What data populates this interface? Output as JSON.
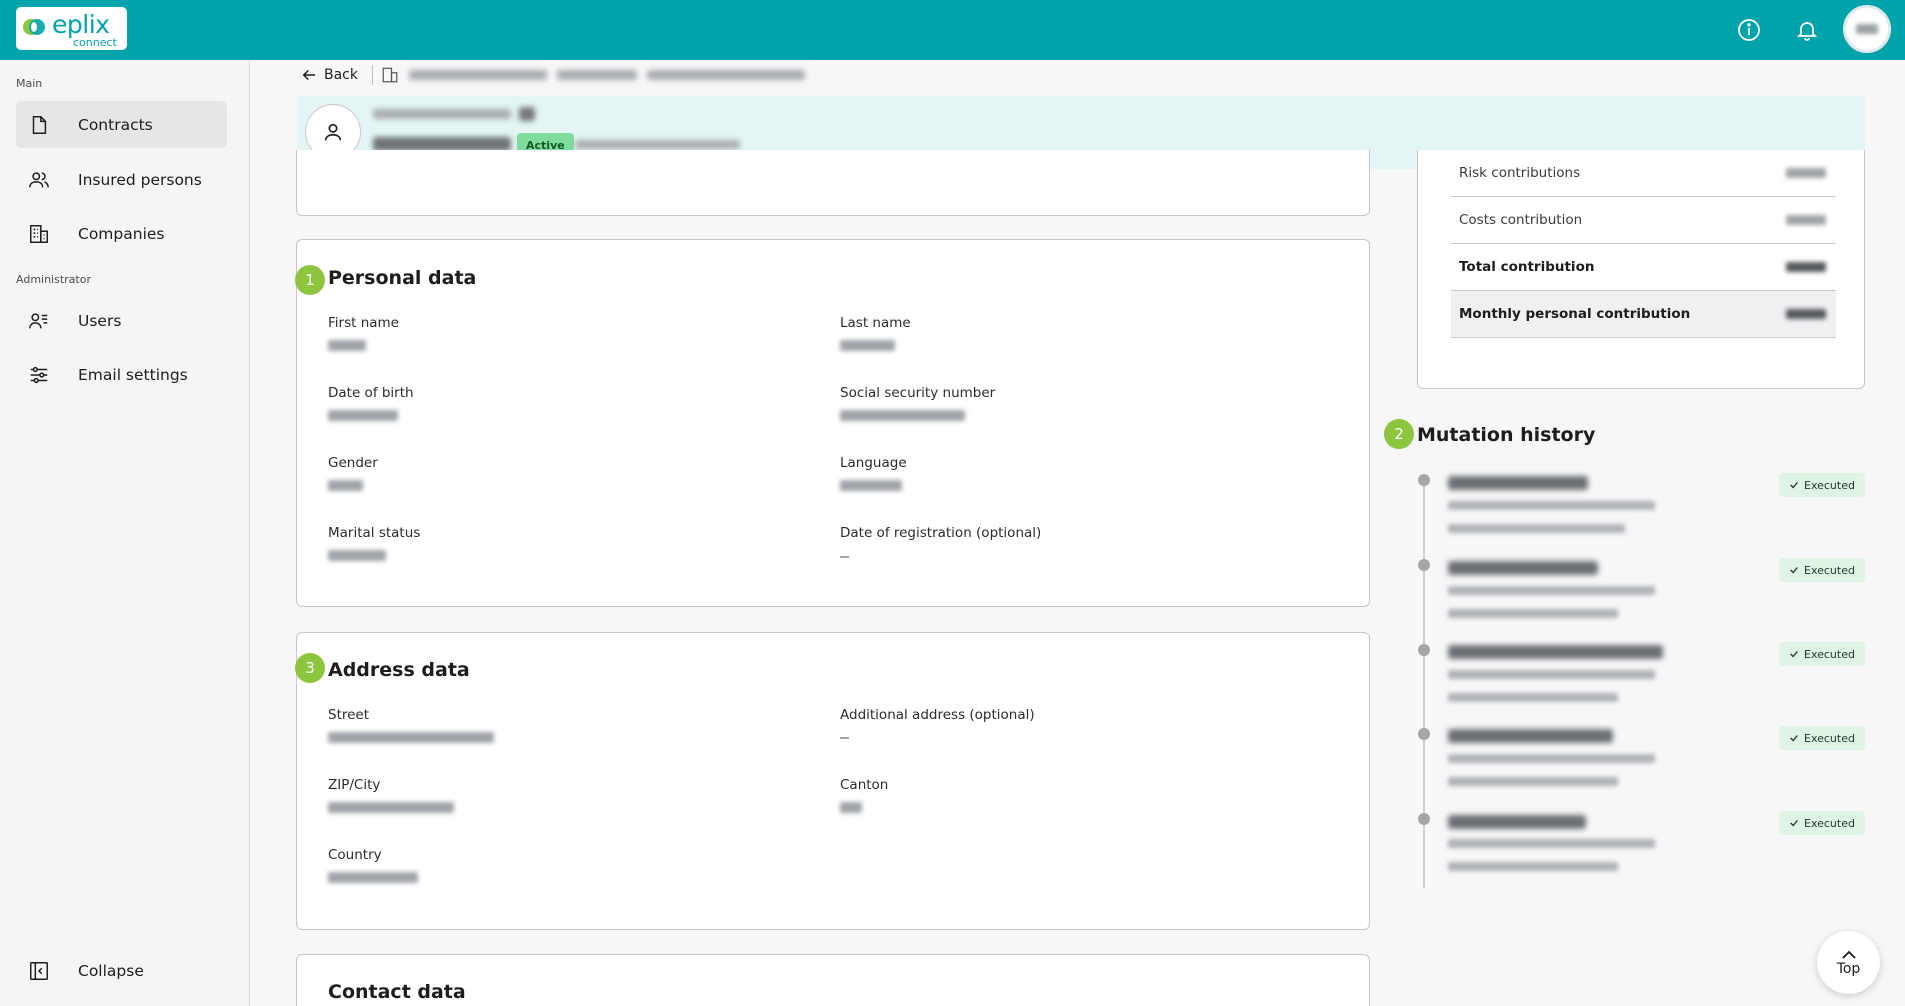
{
  "brand": {
    "word": "eplix",
    "sub": "connect",
    "colors": {
      "primary": "#02a4ac",
      "accent_green": "#8cc63e"
    }
  },
  "topbar": {
    "icons": [
      "info-icon",
      "bell-icon"
    ]
  },
  "sidebar": {
    "section_main": "Main",
    "section_admin": "Administrator",
    "items": [
      {
        "label": "Contracts",
        "icon": "document-icon",
        "active": true
      },
      {
        "label": "Insured persons",
        "icon": "people-icon",
        "active": false
      },
      {
        "label": "Companies",
        "icon": "building-icon",
        "active": false
      },
      {
        "label": "Users",
        "icon": "users-icon",
        "active": false
      },
      {
        "label": "Email settings",
        "icon": "sliders-icon",
        "active": false
      }
    ],
    "collapse_label": "Collapse"
  },
  "breadcrumb": {
    "back_label": "Back"
  },
  "person": {
    "status": "Active"
  },
  "personal_data": {
    "number": "1",
    "title": "Personal data",
    "fields": [
      {
        "label": "First name"
      },
      {
        "label": "Last name"
      },
      {
        "label": "Date of birth"
      },
      {
        "label": "Social security number"
      },
      {
        "label": "Gender"
      },
      {
        "label": "Language"
      },
      {
        "label": "Marital status"
      },
      {
        "label": "Date of registration (optional)"
      }
    ]
  },
  "address_data": {
    "number": "3",
    "title": "Address data",
    "fields": [
      {
        "label": "Street"
      },
      {
        "label": "Additional address (optional)"
      },
      {
        "label": "ZIP/City"
      },
      {
        "label": "Canton"
      },
      {
        "label": "Country"
      }
    ]
  },
  "contact_data": {
    "title": "Contact data"
  },
  "contributions": {
    "rows": [
      {
        "label": "Risk contributions"
      },
      {
        "label": "Costs contribution"
      },
      {
        "label": "Total contribution"
      },
      {
        "label": "Monthly personal contribution"
      }
    ]
  },
  "mutation_history": {
    "number": "2",
    "title": "Mutation history",
    "entries": [
      {
        "status": "Executed"
      },
      {
        "status": "Executed"
      },
      {
        "status": "Executed"
      },
      {
        "status": "Executed"
      },
      {
        "status": "Executed"
      }
    ]
  },
  "top_button": {
    "label": "Top"
  }
}
